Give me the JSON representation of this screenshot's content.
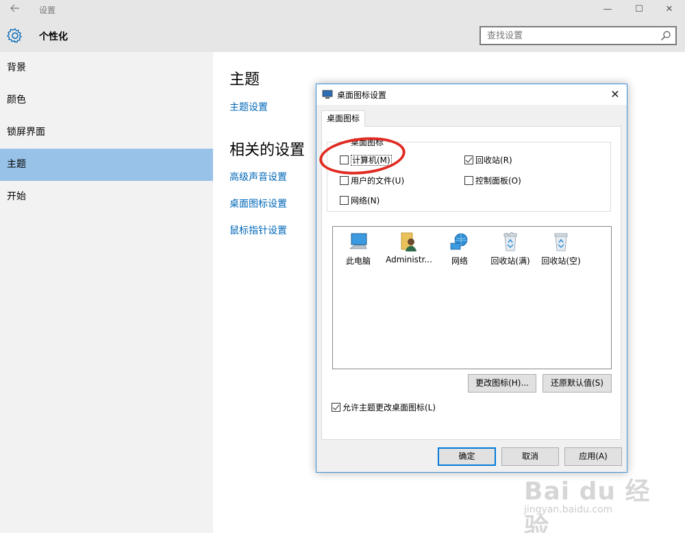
{
  "window": {
    "title": "设置",
    "back_icon": "back-arrow-icon",
    "minimize_glyph": "—",
    "maximize_glyph": "☐",
    "close_glyph": "✕"
  },
  "header": {
    "page_title": "个性化",
    "search_placeholder": "查找设置"
  },
  "sidebar": {
    "items": [
      {
        "label": "背景",
        "active": false
      },
      {
        "label": "颜色",
        "active": false
      },
      {
        "label": "锁屏界面",
        "active": false
      },
      {
        "label": "主题",
        "active": true
      },
      {
        "label": "开始",
        "active": false
      }
    ]
  },
  "content": {
    "section1_title": "主题",
    "section1_link": "主题设置",
    "section2_title": "相关的设置",
    "links": [
      "高级声音设置",
      "桌面图标设置",
      "鼠标指针设置"
    ]
  },
  "dialog": {
    "title": "桌面图标设置",
    "close_glyph": "✕",
    "tab_label": "桌面图标",
    "group_legend": "桌面图标",
    "checkboxes": [
      {
        "label": "计算机(M)",
        "checked": false
      },
      {
        "label": "回收站(R)",
        "checked": true
      },
      {
        "label": "用户的文件(U)",
        "checked": false
      },
      {
        "label": "控制面板(O)",
        "checked": false
      },
      {
        "label": "网络(N)",
        "checked": false
      }
    ],
    "icons": [
      {
        "label": "此电脑",
        "icon": "computer-icon"
      },
      {
        "label": "Administr...",
        "icon": "user-folder-icon"
      },
      {
        "label": "网络",
        "icon": "network-icon"
      },
      {
        "label": "回收站(满)",
        "icon": "recycle-bin-full-icon"
      },
      {
        "label": "回收站(空)",
        "icon": "recycle-bin-empty-icon"
      }
    ],
    "change_icon_button": "更改图标(H)...",
    "restore_default_button": "还原默认值(S)",
    "allow_themes_checkbox": {
      "label": "允许主题更改桌面图标(L)",
      "checked": true
    },
    "ok_button": "确定",
    "cancel_button": "取消",
    "apply_button": "应用(A)"
  },
  "watermark": {
    "logo": "Bai du 经验",
    "url": "jingyan.baidu.com"
  },
  "colors": {
    "accent": "#0067b8",
    "sidebar_active": "#99c2e8",
    "annotation": "#e02a22"
  }
}
